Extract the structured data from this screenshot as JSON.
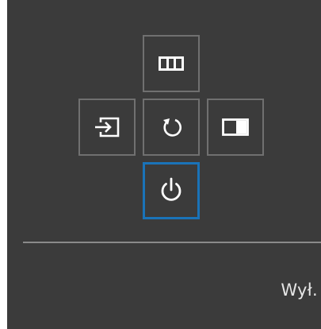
{
  "osd": {
    "buttons": [
      {
        "id": "menu",
        "icon": "menu-columns-icon",
        "selected": false
      },
      {
        "id": "source",
        "icon": "source-input-icon",
        "selected": false
      },
      {
        "id": "return",
        "icon": "return-arrow-icon",
        "selected": false
      },
      {
        "id": "pip",
        "icon": "picture-in-picture-icon",
        "selected": false
      },
      {
        "id": "power",
        "icon": "power-icon",
        "selected": true
      }
    ],
    "selected_label": "Wył.",
    "colors": {
      "background": "#3b3b3b",
      "button_border": "#707070",
      "selected_border": "#1a73b8",
      "icon": "#ffffff",
      "text": "#e6e6e6"
    }
  }
}
